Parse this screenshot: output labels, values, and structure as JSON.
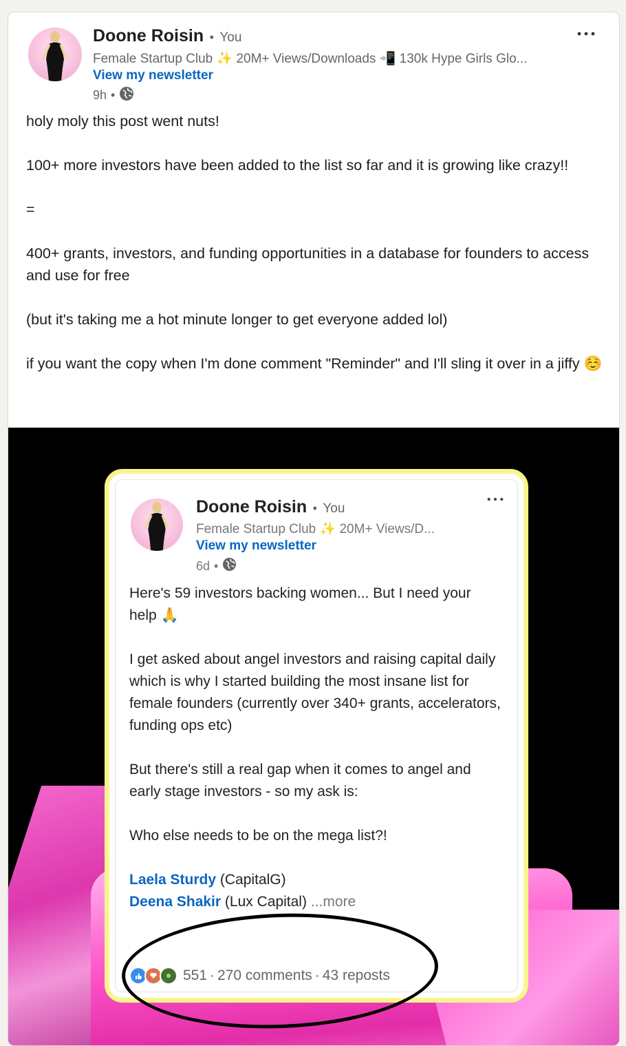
{
  "post": {
    "author": "Doone Roisin",
    "you_label": "You",
    "headline": "Female Startup Club ✨ 20M+ Views/Downloads 📲 130k Hype Girls Glo...",
    "newsletter": "View my newsletter",
    "time": "9h",
    "visibility_icon": "globe-icon",
    "more_icon": "more-dots-icon",
    "body": [
      "holy moly this post went nuts!",
      "",
      "100+ more investors have been added to the list so far and it is growing like crazy!!",
      "",
      "=",
      "",
      "400+ grants, investors, and funding opportunities in a database for founders to access and use for free",
      "",
      "(but it's taking me a hot minute longer to get everyone added lol)",
      "",
      "if you want the copy when I'm done comment \"Reminder\" and I'll sling it over in a jiffy ☺️"
    ]
  },
  "embedded": {
    "author": "Doone Roisin",
    "you_label": "You",
    "headline": "Female Startup Club ✨ 20M+ Views/D...",
    "newsletter": "View my newsletter",
    "time": "6d",
    "body_lines": [
      "Here's 59 investors backing women... But I need your help 🙏",
      "",
      "I get asked about angel investors and raising capital daily which is why I started building the most insane list for female founders (currently over 340+ grants, accelerators, funding ops etc)",
      "",
      "But there's still a real gap when it comes to angel and early stage investors - so my ask is:",
      "",
      "Who else needs to be on the mega list?!",
      ""
    ],
    "mentions": [
      {
        "name": "Laela Sturdy",
        "org": "(CapitalG)"
      },
      {
        "name": "Deena Shakir",
        "org": "(Lux Capital)"
      }
    ],
    "more_label": "...more",
    "reactions_count": "551",
    "comments": "270 comments",
    "reposts": "43 reposts",
    "sep": "·"
  },
  "colors": {
    "link": "#0a66c2",
    "highlight_border": "#f6f58a",
    "media_bg": "#000000",
    "accent_pink": "#ff54c9"
  }
}
